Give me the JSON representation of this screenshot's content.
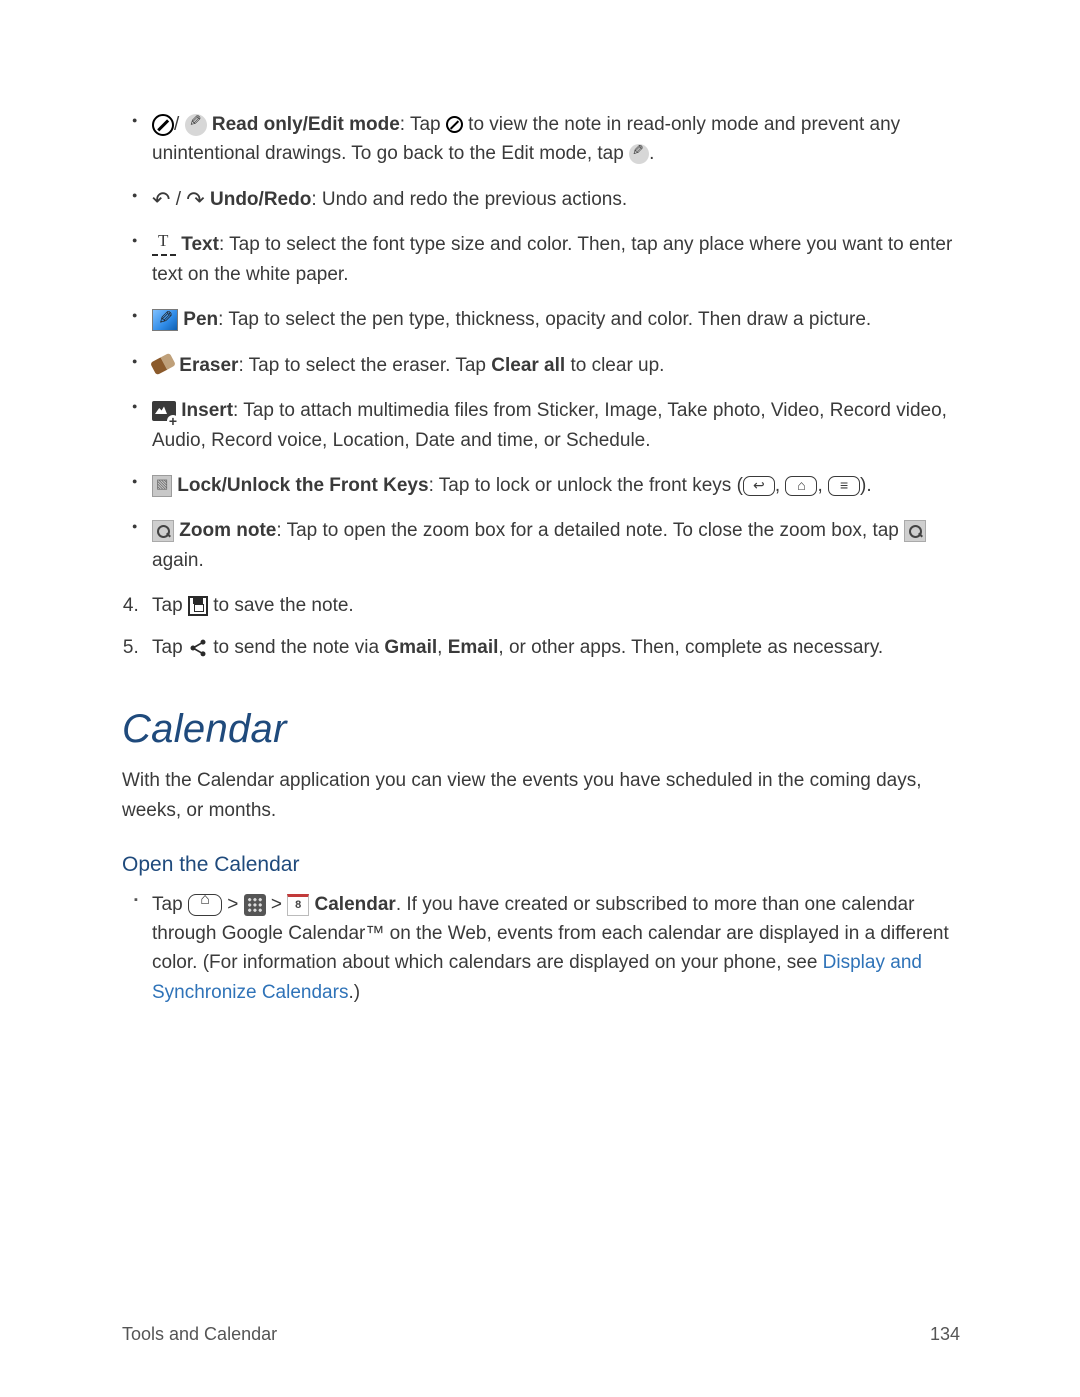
{
  "bullets": {
    "readEdit": {
      "label": "Read only/Edit mode",
      "p1": ": Tap ",
      "p2": " to view the note in read-only mode and prevent any unintentional drawings. To go back to the Edit mode, tap ",
      "p3": "."
    },
    "undoRedo": {
      "label": "Undo/Redo",
      "text": ": Undo and redo the previous actions."
    },
    "text": {
      "label": "Text",
      "text": ": Tap to select the font type size and color. Then, tap any place where you want to enter text on the white paper."
    },
    "pen": {
      "label": "Pen",
      "text": ": Tap to select the pen type, thickness, opacity and color. Then draw a picture."
    },
    "eraser": {
      "label": "Eraser",
      "p1": ": Tap to select the eraser. Tap ",
      "boldClear": "Clear all",
      "p2": " to clear up."
    },
    "insert": {
      "label": "Insert",
      "text": ": Tap to attach multimedia files from Sticker, Image, Take photo, Video, Record video, Audio, Record voice, Location, Date and time, or Schedule."
    },
    "lock": {
      "label": "Lock/Unlock the Front Keys",
      "p1": ": Tap to lock or unlock the front keys (",
      "sep": ", ",
      "p2": ")."
    },
    "zoom": {
      "label": "Zoom note",
      "p1": ": Tap to open the zoom box for a detailed note. To close the zoom box, tap ",
      "p2": " again."
    }
  },
  "steps": {
    "four": {
      "p1": "Tap ",
      "p2": " to save the note."
    },
    "five": {
      "p1": "Tap ",
      "p2": " to send the note via ",
      "gmail": "Gmail",
      "sep1": ", ",
      "email": "Email",
      "p3": ", or other apps. Then, complete as necessary."
    }
  },
  "calendar": {
    "heading": "Calendar",
    "intro": "With the Calendar application you can view the events you have scheduled in the coming days, weeks, or months.",
    "openHeading": "Open the Calendar",
    "open": {
      "tap": "Tap ",
      "gt1": " > ",
      "gt2": " > ",
      "label": " Calendar",
      "p1": ". If you have created or subscribed to more than one calendar through Google Calendar™ on the Web, events from each calendar are displayed in a different color. (For information about which calendars are displayed on your phone, see ",
      "link": "Display and Synchronize Calendars",
      "p2": ".)",
      "calNum": "8"
    }
  },
  "keycaps": {
    "back": "↩",
    "home": "⌂",
    "menu": "≡"
  },
  "footer": {
    "section": "Tools and Calendar",
    "page": "134"
  }
}
